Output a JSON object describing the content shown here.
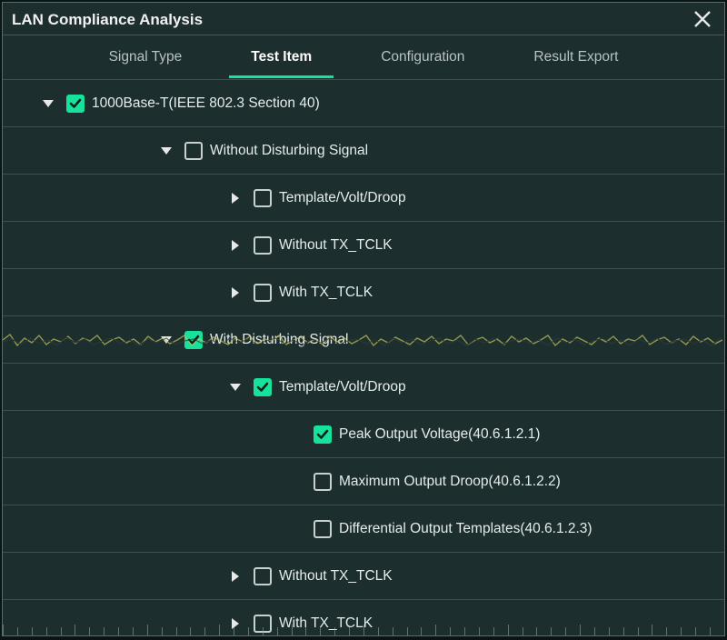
{
  "dialog": {
    "title": "LAN Compliance Analysis"
  },
  "tabs": [
    {
      "label": "Signal Type",
      "active": false
    },
    {
      "label": "Test Item",
      "active": true
    },
    {
      "label": "Configuration",
      "active": false
    },
    {
      "label": "Result Export",
      "active": false
    }
  ],
  "tree": [
    {
      "indent": 0,
      "expand": "down",
      "checked": true,
      "label": "1000Base-T(IEEE 802.3 Section 40)"
    },
    {
      "indent": 1,
      "expand": "down",
      "checked": false,
      "label": "Without Disturbing Signal"
    },
    {
      "indent": 2,
      "expand": "right",
      "checked": false,
      "label": "Template/Volt/Droop"
    },
    {
      "indent": 2,
      "expand": "right",
      "checked": false,
      "label": "Without TX_TCLK"
    },
    {
      "indent": 2,
      "expand": "right",
      "checked": false,
      "label": "With TX_TCLK"
    },
    {
      "indent": 1,
      "expand": "down",
      "checked": true,
      "label": "With Disturbing Signal"
    },
    {
      "indent": 2,
      "expand": "down",
      "checked": true,
      "label": "Template/Volt/Droop"
    },
    {
      "indent": 3,
      "expand": "none",
      "checked": true,
      "label": "Peak Output Voltage(40.6.1.2.1)"
    },
    {
      "indent": 3,
      "expand": "none",
      "checked": false,
      "label": "Maximum Output Droop(40.6.1.2.2)"
    },
    {
      "indent": 3,
      "expand": "none",
      "checked": false,
      "label": "Differential Output Templates(40.6.1.2.3)"
    },
    {
      "indent": 2,
      "expand": "right",
      "checked": false,
      "label": "Without TX_TCLK"
    },
    {
      "indent": 2,
      "expand": "right",
      "checked": false,
      "label": "With TX_TCLK"
    }
  ],
  "colors": {
    "accent": "#16e29b",
    "bg": "#1d2e2e",
    "border": "#3f5050"
  }
}
